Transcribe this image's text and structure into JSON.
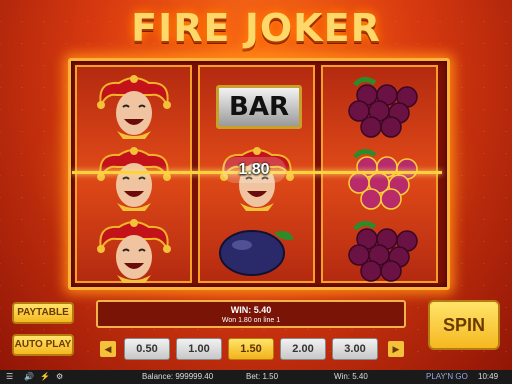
{
  "game": {
    "title": "FIRE JOKER"
  },
  "reels": {
    "reel1": [
      "joker",
      "joker",
      "joker"
    ],
    "reel2": [
      "bar",
      "joker",
      "plum"
    ],
    "reel3": [
      "grapes",
      "grapes",
      "grapes"
    ],
    "bar_label": "BAR",
    "win_value": "1.80"
  },
  "buttons": {
    "paytable": "PAYTABLE",
    "autoplay": "AUTO PLAY",
    "spin": "SPIN"
  },
  "win_panel": {
    "win_text": "WIN:  5.40",
    "detail": "Won 1.80 on line 1"
  },
  "bets": {
    "options": [
      "0.50",
      "1.00",
      "1.50",
      "2.00",
      "3.00"
    ],
    "selected": "1.50"
  },
  "status": {
    "balance": "Balance: 999999.40",
    "bet": "Bet: 1.50",
    "win": "Win: 5.40",
    "brand": "PLAY'N GO",
    "time": "10:49"
  },
  "colors": {
    "gold": "#ffd86a",
    "reel_red": "#e04a18",
    "panel": "#7a1406"
  }
}
